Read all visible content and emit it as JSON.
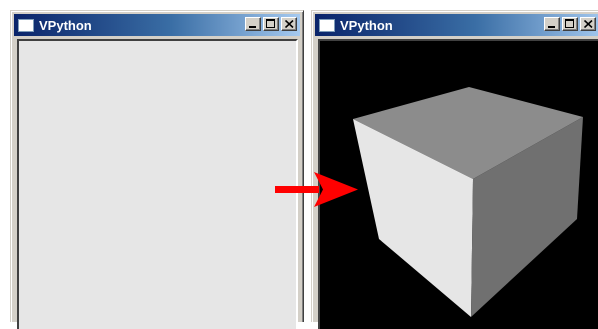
{
  "windows": [
    {
      "title": "VPython",
      "canvas_background": "#e6e6e6"
    },
    {
      "title": "VPython",
      "canvas_background": "#000000"
    }
  ],
  "title_bar_buttons": [
    "minimize-icon",
    "maximize-icon",
    "close-icon"
  ],
  "scene": {
    "object": "box",
    "face_colors": {
      "top": "#8c8c8c",
      "front": "#e6e6e6",
      "side": "#707070"
    }
  },
  "annotation": {
    "arrow_color": "#ff0000",
    "icon": "right-arrow-icon"
  }
}
